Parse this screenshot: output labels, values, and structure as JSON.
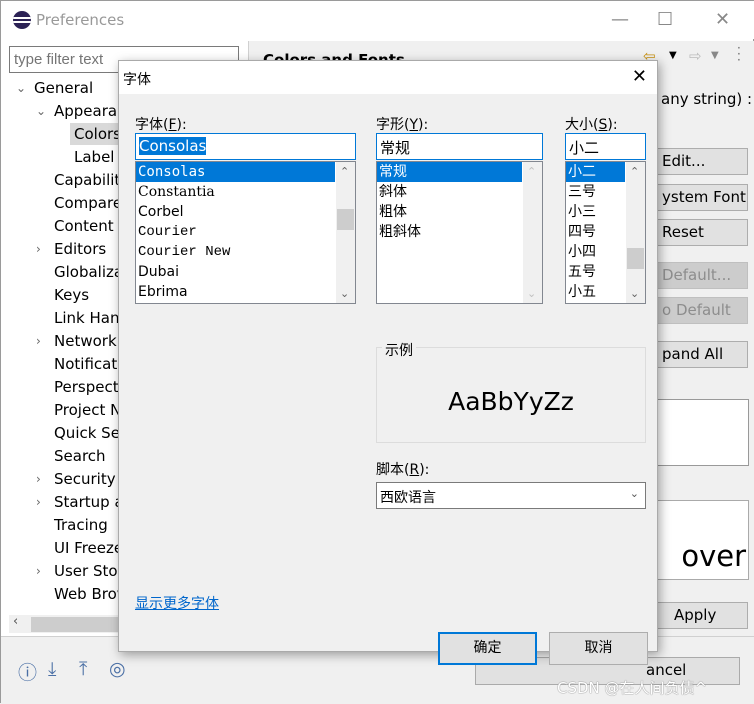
{
  "window": {
    "title": "Preferences",
    "minimize": "—",
    "maximize": "☐",
    "close": "✕"
  },
  "filter": {
    "placeholder": "type filter text"
  },
  "tree": [
    {
      "label": "General",
      "expanded": true,
      "level": 0
    },
    {
      "label": "Appearar",
      "expanded": true,
      "level": 1
    },
    {
      "label": "Colors",
      "level": 2,
      "selected": true
    },
    {
      "label": "Label I",
      "level": 2
    },
    {
      "label": "Capabiliti",
      "level": 1
    },
    {
      "label": "Compare",
      "level": 1
    },
    {
      "label": "Content T",
      "level": 1
    },
    {
      "label": "Editors",
      "level": 1,
      "collapsed": true
    },
    {
      "label": "Globaliza",
      "level": 1
    },
    {
      "label": "Keys",
      "level": 1
    },
    {
      "label": "Link Hanc",
      "level": 1
    },
    {
      "label": "Network",
      "level": 1,
      "collapsed": true
    },
    {
      "label": "Notificati",
      "level": 1
    },
    {
      "label": "Perspecti",
      "level": 1
    },
    {
      "label": "Project N",
      "level": 1
    },
    {
      "label": "Quick Sea",
      "level": 1
    },
    {
      "label": "Search",
      "level": 1
    },
    {
      "label": "Security",
      "level": 1,
      "collapsed": true
    },
    {
      "label": "Startup a",
      "level": 1,
      "collapsed": true
    },
    {
      "label": "Tracing",
      "level": 1
    },
    {
      "label": "UI Freeze",
      "level": 1
    },
    {
      "label": "User Stor",
      "level": 1,
      "collapsed": true
    },
    {
      "label": "Web Brov",
      "level": 1
    }
  ],
  "right": {
    "title": "Colors and Fonts",
    "hint": "any string) :",
    "buttons": [
      {
        "label": "Edit..."
      },
      {
        "label": "ystem Font"
      },
      {
        "label": "Reset"
      },
      {
        "label": "Default...",
        "disabled": true
      },
      {
        "label": "o Default",
        "disabled": true
      },
      {
        "label": "pand All"
      }
    ],
    "preview_text": "over",
    "apply": "Apply",
    "cancel": "ancel"
  },
  "watermark": "CSDN @在人间负债^",
  "dialog": {
    "title": "字体",
    "close": "✕",
    "font": {
      "label": "字体(",
      "key": "F",
      "label_end": "):",
      "value": "Consolas",
      "items": [
        "Consolas",
        "Constantia",
        "Corbel",
        "Courier",
        "Courier New",
        "Dubai",
        "Ebrima"
      ],
      "selected": 0
    },
    "style": {
      "label": "字形(",
      "key": "Y",
      "label_end": "):",
      "value": "常规",
      "items": [
        "常规",
        "斜体",
        "粗体",
        "粗斜体"
      ],
      "selected": 0
    },
    "size": {
      "label": "大小(",
      "key": "S",
      "label_end": "):",
      "value": "小二",
      "items": [
        "小二",
        "三号",
        "小三",
        "四号",
        "小四",
        "五号",
        "小五"
      ],
      "selected": 0
    },
    "sample": {
      "label": "示例",
      "text": "AaBbYyZz"
    },
    "script": {
      "label": "脚本(",
      "key": "R",
      "label_end": "):",
      "value": "西欧语言"
    },
    "more_fonts": "显示更多字体",
    "ok": "确定",
    "cancel": "取消"
  },
  "colors": {
    "accent": "#0078d7",
    "link": "#0066cc"
  }
}
